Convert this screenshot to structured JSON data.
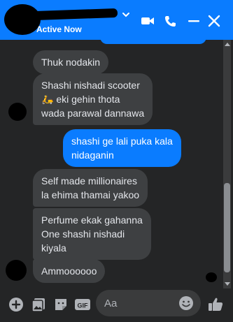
{
  "header": {
    "status": "Active Now",
    "icons": [
      "chevron-down-icon",
      "video-call-icon",
      "phone-icon",
      "minimize-icon",
      "close-icon"
    ],
    "accent": "#0a7cff"
  },
  "messages": [
    {
      "sender": "them",
      "text": "Thuk nodakin"
    },
    {
      "sender": "them",
      "text": "Shashi nishadi scooter\n🛵 eki gehin thota\nwada parawal dannawa"
    },
    {
      "sender": "me",
      "text": "shashi ge lali puka kala\nnidaganin"
    },
    {
      "sender": "them",
      "text": "Self made millionaires\nla ehima thamai yakoo"
    },
    {
      "sender": "them",
      "text": "Perfume ekak gahanna\nOne shashi nishadi\nkiyala"
    },
    {
      "sender": "them",
      "text": "Ammoooooo"
    }
  ],
  "composer": {
    "placeholder": "Aa",
    "icons": [
      "add-icon",
      "photo-icon",
      "sticker-icon",
      "gif-icon",
      "emoji-icon",
      "like-icon"
    ]
  },
  "colors": {
    "bubble_in": "#3e4042",
    "bubble_out": "#0a7cff",
    "background": "#242526"
  }
}
